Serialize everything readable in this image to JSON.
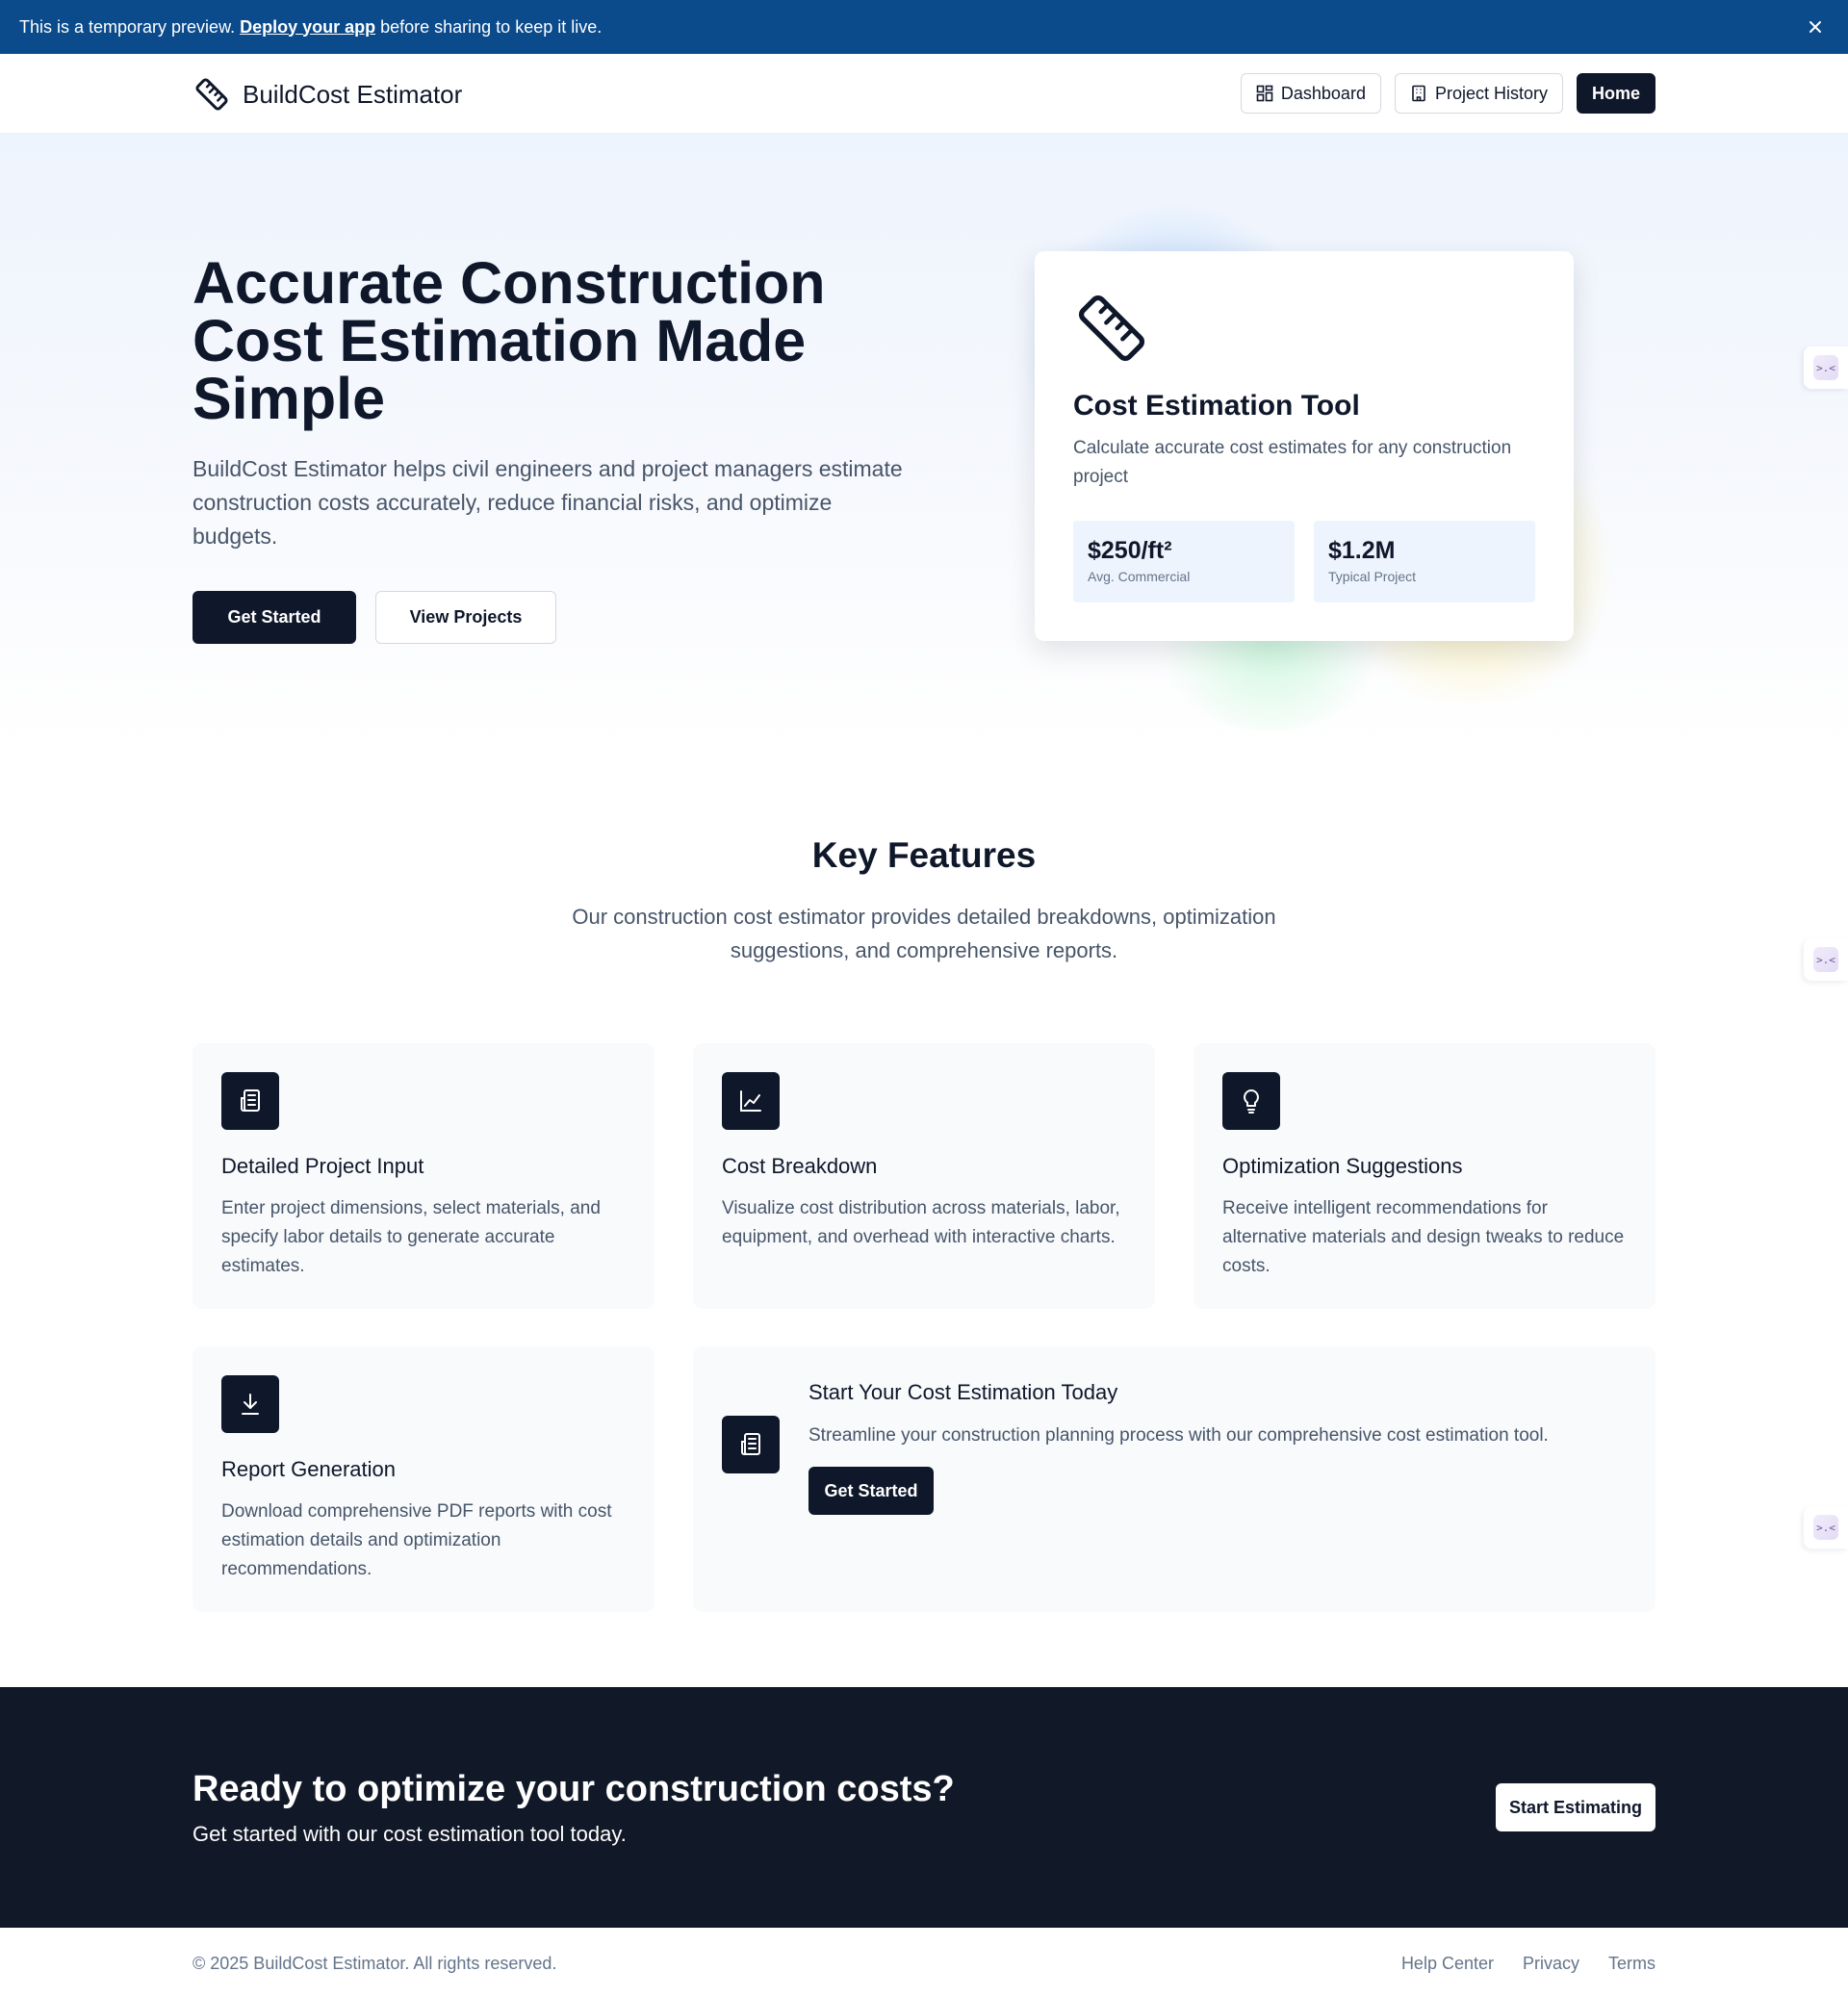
{
  "banner": {
    "text_before": "This is a temporary preview.",
    "link_text": "Deploy your app",
    "text_after": "before sharing to keep it live."
  },
  "header": {
    "brand": "BuildCost Estimator",
    "nav": {
      "dashboard": "Dashboard",
      "project_history": "Project History",
      "home": "Home"
    }
  },
  "hero": {
    "title": "Accurate Construction Cost Estimation Made Simple",
    "lead": "BuildCost Estimator helps civil engineers and project managers estimate construction costs accurately, reduce financial risks, and optimize budgets.",
    "primary_button": "Get Started",
    "secondary_button": "View Projects",
    "tool_card": {
      "title": "Cost Estimation Tool",
      "description": "Calculate accurate cost estimates for any construction project",
      "stats": [
        {
          "value": "$250/ft²",
          "label": "Avg. Commercial"
        },
        {
          "value": "$1.2M",
          "label": "Typical Project"
        }
      ]
    }
  },
  "features": {
    "title": "Key Features",
    "subtitle": "Our construction cost estimator provides detailed breakdowns, optimization suggestions, and comprehensive reports.",
    "cards": [
      {
        "icon": "document-icon",
        "title": "Detailed Project Input",
        "text": "Enter project dimensions, select materials, and specify labor details to generate accurate estimates."
      },
      {
        "icon": "line-chart-icon",
        "title": "Cost Breakdown",
        "text": "Visualize cost distribution across materials, labor, equipment, and overhead with interactive charts."
      },
      {
        "icon": "lightbulb-icon",
        "title": "Optimization Suggestions",
        "text": "Receive intelligent recommendations for alternative materials and design tweaks to reduce costs."
      },
      {
        "icon": "download-icon",
        "title": "Report Generation",
        "text": "Download comprehensive PDF reports with cost estimation details and optimization recommendations."
      }
    ],
    "cta_card": {
      "title": "Start Your Cost Estimation Today",
      "text": "Streamline your construction planning process with our comprehensive cost estimation tool.",
      "button": "Get Started"
    }
  },
  "cta_section": {
    "title": "Ready to optimize your construction costs?",
    "subtitle": "Get started with our cost estimation tool today.",
    "button": "Start Estimating"
  },
  "footer": {
    "copyright": "© 2025 BuildCost Estimator. All rights reserved.",
    "links": [
      "Help Center",
      "Privacy",
      "Terms"
    ]
  },
  "side_widget": {
    "label": ">.<"
  },
  "colors": {
    "banner": "#0b4a8b",
    "primary": "#0f172a",
    "dark_section": "#111827",
    "card_bg": "#f8fafc",
    "stat_bg": "#eef4fd"
  }
}
